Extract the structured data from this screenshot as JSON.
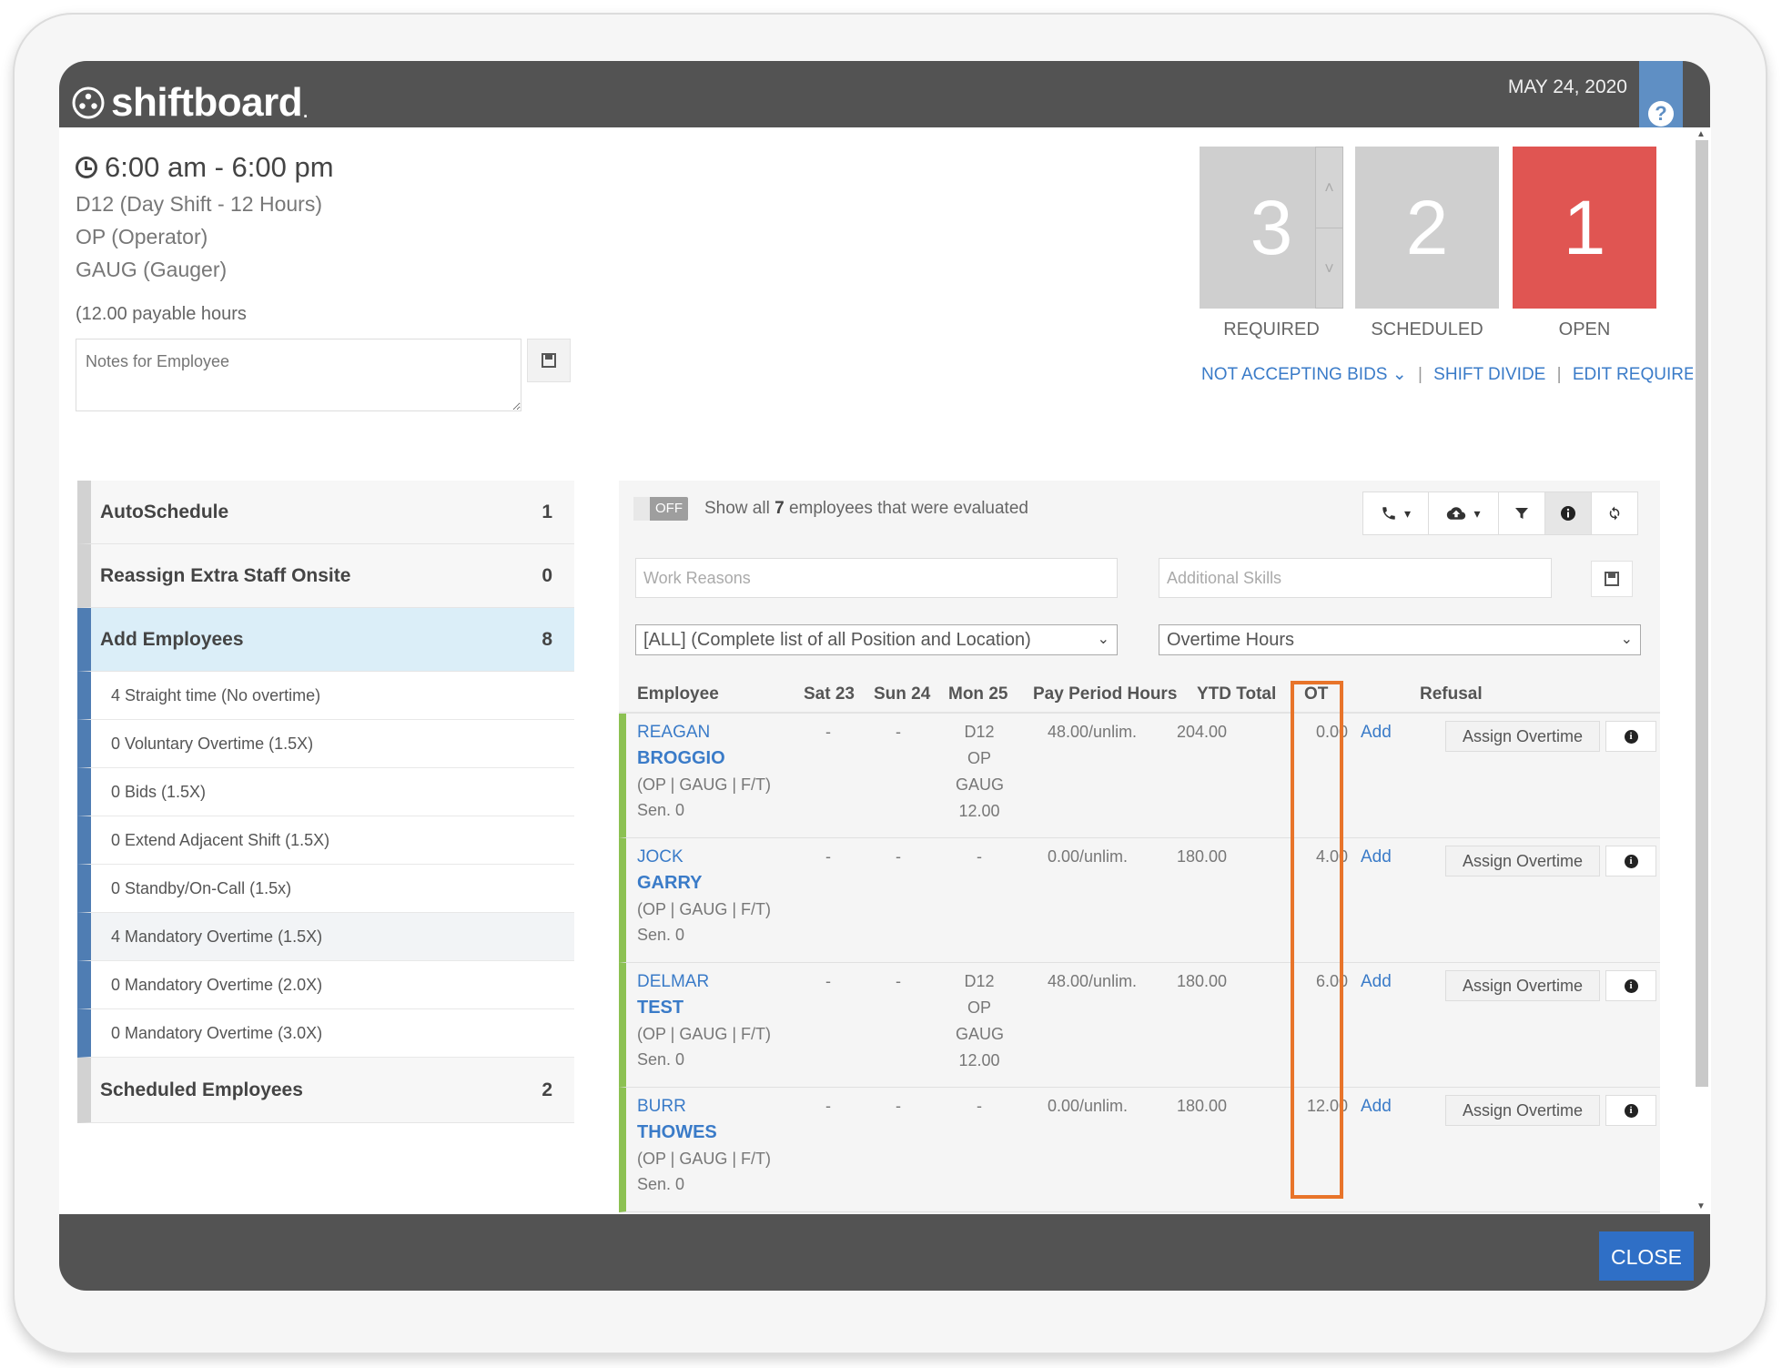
{
  "header": {
    "logo_text": "shiftboard",
    "logo_dot": ".",
    "date": "MAY 24, 2020",
    "help": "?"
  },
  "shift": {
    "time": "6:00 am - 6:00 pm",
    "name": "D12 (Day Shift - 12 Hours)",
    "position": "OP (Operator)",
    "skill": "GAUG (Gauger)",
    "payable": "(12.00 payable hours",
    "notes_placeholder": "Notes for Employee"
  },
  "stats": {
    "required": {
      "value": "3",
      "label": "REQUIRED"
    },
    "scheduled": {
      "value": "2",
      "label": "SCHEDULED"
    },
    "open": {
      "value": "1",
      "label": "OPEN"
    },
    "stepper_up": "˄",
    "stepper_down": "˅"
  },
  "links": {
    "bids": "NOT ACCEPTING BIDS",
    "bids_caret": "⌄",
    "sep": "|",
    "divide": "SHIFT DIVIDE",
    "edit": "EDIT REQUIREMENT"
  },
  "sidebar": {
    "items": [
      {
        "label": "AutoSchedule",
        "count": "1"
      },
      {
        "label": "Reassign Extra Staff Onsite",
        "count": "0"
      },
      {
        "label": "Add Employees",
        "count": "8"
      }
    ],
    "subitems": [
      "4 Straight time (No overtime)",
      "0 Voluntary Overtime (1.5X)",
      "0 Bids (1.5X)",
      "0 Extend Adjacent Shift (1.5X)",
      "0 Standby/On-Call (1.5x)",
      "4 Mandatory Overtime (1.5X)",
      "0 Mandatory Overtime (2.0X)",
      "0 Mandatory Overtime (3.0X)"
    ],
    "scheduled": {
      "label": "Scheduled Employees",
      "count": "2"
    }
  },
  "panel": {
    "toggle": "OFF",
    "show_pre": "Show all ",
    "show_count": "7",
    "show_post": " employees that were evaluated",
    "work_reasons_placeholder": "Work Reasons",
    "skills_placeholder": "Additional Skills",
    "position_select": "[ALL] (Complete list of all Position and Location)",
    "sort_select": "Overtime Hours",
    "caret": "▾",
    "chevron": "⌄"
  },
  "table": {
    "headers": {
      "employee": "Employee",
      "sat": "Sat 23",
      "sun": "Sun 24",
      "mon": "Mon 25",
      "pay": "Pay Period Hours",
      "ytd": "YTD Total",
      "ot": "OT",
      "refusal": "Refusal"
    },
    "rows": [
      {
        "first": "REAGAN",
        "last": "BROGGIO",
        "detail": "(OP | GAUG | F/T)",
        "sen": "Sen. 0",
        "sat": "-",
        "sun": "-",
        "mon": [
          "D12",
          "OP",
          "GAUG",
          "12.00"
        ],
        "pay": "48.00/unlim.",
        "ytd": "204.00",
        "ot": "0.00",
        "add": "Add",
        "assign": "Assign Overtime"
      },
      {
        "first": "JOCK",
        "last": "GARRY",
        "detail": "(OP | GAUG | F/T)",
        "sen": "Sen. 0",
        "sat": "-",
        "sun": "-",
        "mon": [
          "-"
        ],
        "pay": "0.00/unlim.",
        "ytd": "180.00",
        "ot": "4.00",
        "add": "Add",
        "assign": "Assign Overtime"
      },
      {
        "first": "DELMAR",
        "last": "TEST",
        "detail": "(OP | GAUG | F/T)",
        "sen": "Sen. 0",
        "sat": "-",
        "sun": "-",
        "mon": [
          "D12",
          "OP",
          "GAUG",
          "12.00"
        ],
        "pay": "48.00/unlim.",
        "ytd": "180.00",
        "ot": "6.00",
        "add": "Add",
        "assign": "Assign Overtime"
      },
      {
        "first": "BURR",
        "last": "THOWES",
        "detail": "(OP | GAUG | F/T)",
        "sen": "Sen. 0",
        "sat": "-",
        "sun": "-",
        "mon": [
          "-"
        ],
        "pay": "0.00/unlim.",
        "ytd": "180.00",
        "ot": "12.00",
        "add": "Add",
        "assign": "Assign Overtime"
      }
    ]
  },
  "footer": {
    "close": "CLOSE"
  },
  "colors": {
    "topbar": "#535353",
    "accent_blue": "#3a7bc8",
    "open_red": "#e05552",
    "ot_highlight": "#e8742a",
    "row_green": "#8cc152"
  }
}
